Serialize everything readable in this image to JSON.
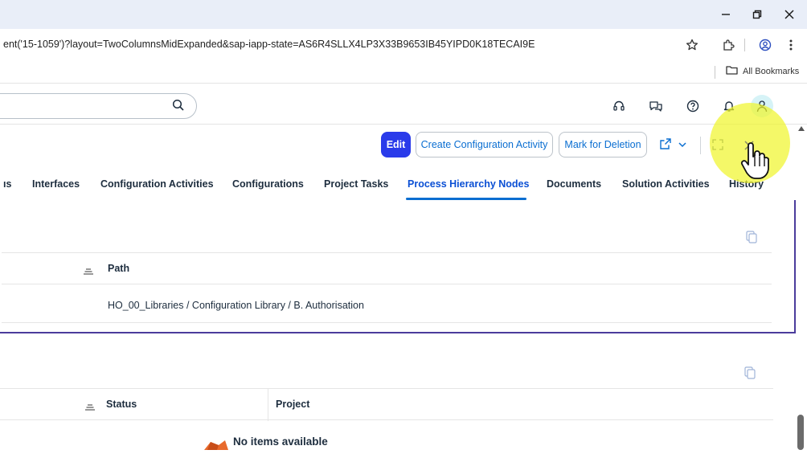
{
  "browser": {
    "url": "ent('15-1059')?layout=TwoColumnsMidExpanded&sap-iapp-state=AS6R4SLLX4LP3X33B9653IB45YIPD0K18TECAI9E",
    "bookmarks_label": "All Bookmarks",
    "window_controls": [
      "minimize-icon",
      "restore-icon",
      "close-icon"
    ],
    "address_icons": [
      "star-icon",
      "extensions-icon",
      "profile-icon",
      "more-vertical-icon"
    ]
  },
  "shell": {
    "search_placeholder": "",
    "icons": [
      "headset-icon",
      "feedback-icon",
      "help-icon",
      "notifications-icon",
      "user-avatar-icon"
    ]
  },
  "toolbar": {
    "edit_label": "Edit",
    "create_config_label": "Create Configuration Activity",
    "mark_deletion_label": "Mark for Deletion",
    "share_icon": "share-icon",
    "fullscreen_icon": "fullscreen-icon",
    "close_icon": "close-icon"
  },
  "tabs": {
    "items": [
      {
        "label": "ıs"
      },
      {
        "label": "Interfaces"
      },
      {
        "label": "Configuration Activities"
      },
      {
        "label": "Configurations"
      },
      {
        "label": "Project Tasks"
      },
      {
        "label": "Process Hierarchy Nodes"
      },
      {
        "label": "Documents"
      },
      {
        "label": "Solution Activities"
      },
      {
        "label": "History"
      }
    ],
    "active_index": 5
  },
  "section1": {
    "columns": [
      {
        "label": "Path"
      }
    ],
    "rows": [
      {
        "path": "HO_00_Libraries / Configuration Library / B. Authorisation"
      }
    ]
  },
  "section2": {
    "columns": [
      {
        "label": "Status"
      },
      {
        "label": "Project"
      }
    ],
    "empty_text": "No items available"
  },
  "colors": {
    "accent": "#0a6ed1",
    "primary_button": "#2a3bea",
    "focus_border": "#4b3c9c",
    "highlight": "#f0f528"
  }
}
